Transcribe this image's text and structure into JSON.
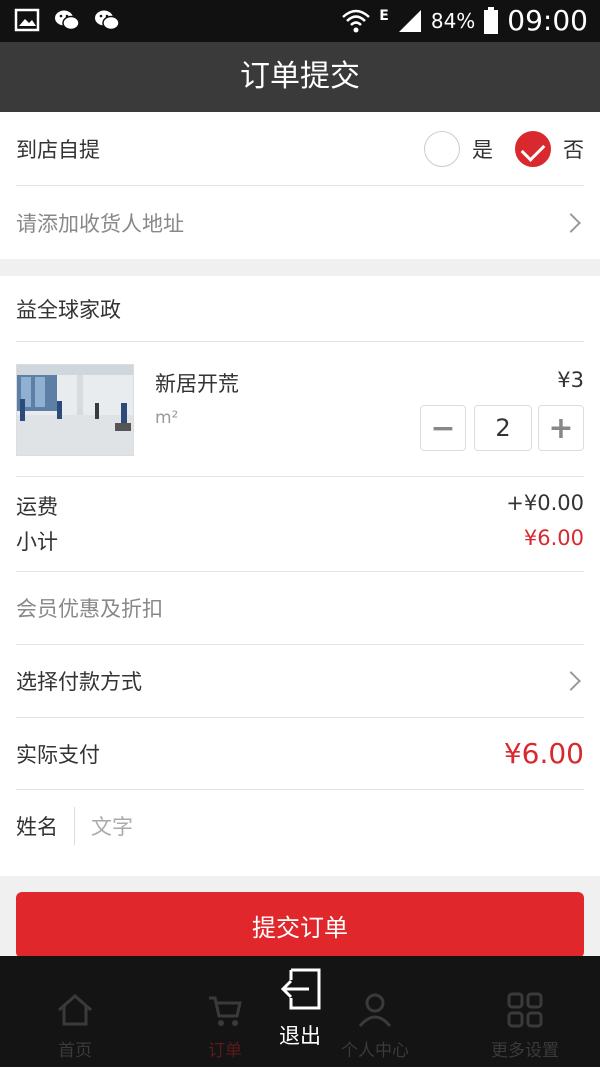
{
  "status_bar": {
    "battery": "84%",
    "time": "09:00",
    "network": "E"
  },
  "header": {
    "title": "订单提交"
  },
  "pickup": {
    "label": "到店自提",
    "yes": "是",
    "no": "否",
    "selected": "否"
  },
  "address": {
    "placeholder": "请添加收货人地址"
  },
  "shop": {
    "name": "益全球家政"
  },
  "item": {
    "name": "新居开荒",
    "unit": "m²",
    "price": "¥3",
    "quantity": "2",
    "minus": "−",
    "plus": "+"
  },
  "summary": {
    "shipping_label": "运费",
    "shipping_value": "+¥0.00",
    "subtotal_label": "小计",
    "subtotal_value": "¥6.00"
  },
  "discount": {
    "label": "会员优惠及折扣"
  },
  "payment": {
    "label": "选择付款方式"
  },
  "actual": {
    "label": "实际支付",
    "value": "¥6.00"
  },
  "name_field": {
    "label": "姓名",
    "placeholder": "文字"
  },
  "submit": {
    "label": "提交订单"
  },
  "tabbar": {
    "tabs": [
      {
        "label": "首页"
      },
      {
        "label": "订单"
      },
      {
        "label": "个人中心"
      },
      {
        "label": "更多设置"
      }
    ],
    "exit_label": "退出"
  },
  "colors": {
    "accent": "#d9282e",
    "header": "#3a3a3a"
  }
}
